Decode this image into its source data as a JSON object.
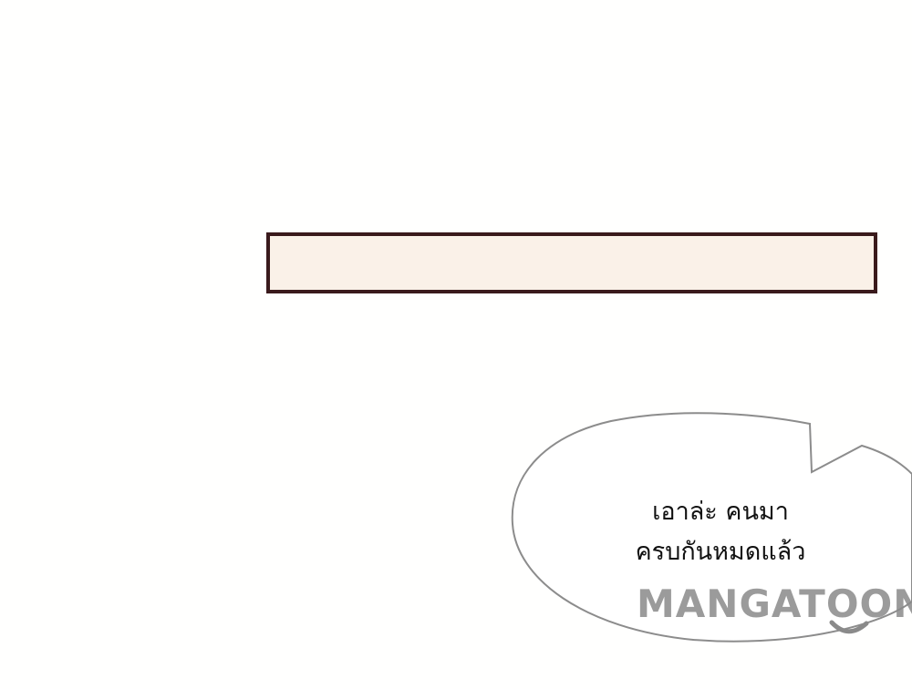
{
  "panel": {
    "bubble_lines": [
      "เอาล่ะ คนมา",
      "ครบกันหมดแล้ว"
    ]
  },
  "watermark": {
    "text": "MANGATOON"
  },
  "colors": {
    "caption_fill": "#faf1e8",
    "caption_border": "#3a1a1c",
    "bubble_outline": "#8c8c8c",
    "watermark": "#8a8a8a"
  }
}
